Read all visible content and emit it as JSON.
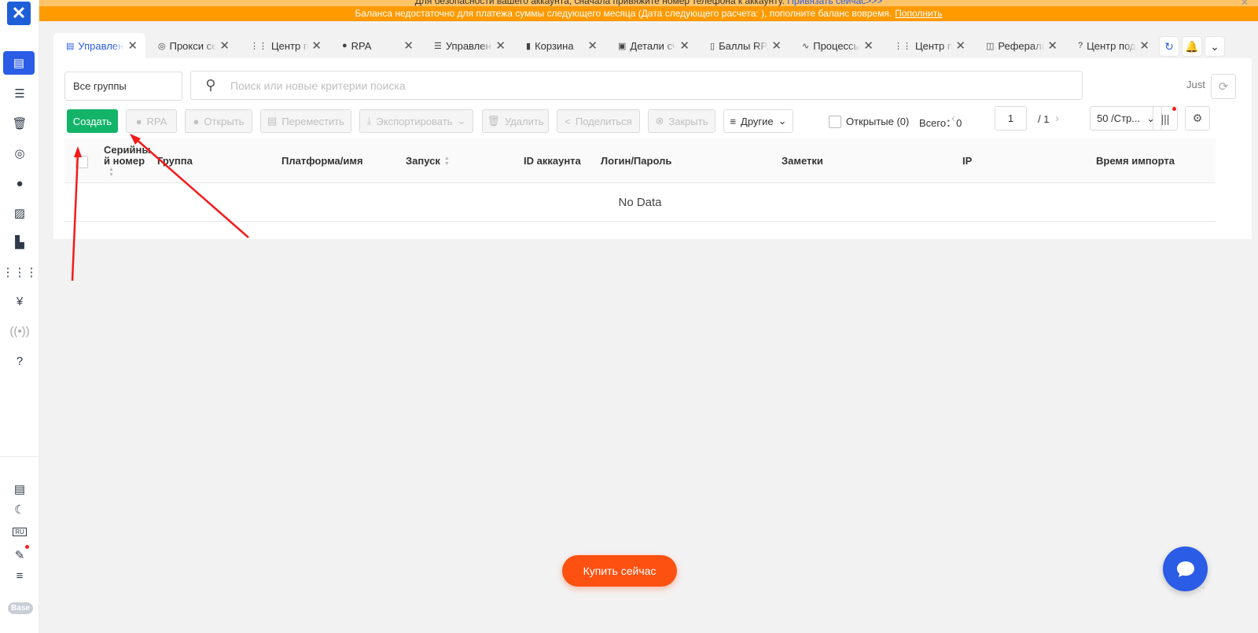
{
  "app": {
    "logo_glyph": "✕",
    "brand_color": "#2b5ce6"
  },
  "banners": {
    "security_text": "Для безопасности вашего аккаунта, сначала привяжите номер телефона к аккаунту.",
    "security_link": "Привязать сейчас>>>",
    "balance_text": "Баланса недостаточно для платежа суммы следующего месяца (Дата следующего расчета: ), пополните баланс вовремя.",
    "balance_link": "Пополнить"
  },
  "tabs": [
    {
      "label": "Управление",
      "icon": "doc-icon"
    },
    {
      "label": "Прокси серверы",
      "icon": "signal-icon"
    },
    {
      "label": "Центр приложений",
      "icon": "grid-icon"
    },
    {
      "label": "RPA",
      "icon": "robot-icon"
    },
    {
      "label": "Управление",
      "icon": "server-icon"
    },
    {
      "label": "Корзина",
      "icon": "trash-icon"
    },
    {
      "label": "Детали счета",
      "icon": "ledger-icon"
    },
    {
      "label": "Баллы RPA",
      "icon": "file-icon"
    },
    {
      "label": "Процессы",
      "icon": "pulse-icon"
    },
    {
      "label": "Центр приложений",
      "icon": "grid-icon"
    },
    {
      "label": "Рефералы",
      "icon": "referral-icon"
    },
    {
      "label": "Центр поддержки",
      "icon": "help-icon"
    }
  ],
  "toolbar": {
    "group_select": "Все группы",
    "search_placeholder": "Поиск или новые критерии поиска",
    "just": "Just",
    "create": "Создать",
    "rpa": "RPA",
    "open": "Открыть",
    "move": "Переместить",
    "export": "Экспортировать",
    "delete": "Удалить",
    "share": "Поделиться",
    "close": "Закрыть",
    "other": "Другие",
    "opened": "Открытые (0)",
    "total_label": "Всего：",
    "total_value": "0",
    "page": "1",
    "page_total": "/ 1",
    "page_size": "50 /Стр..."
  },
  "table": {
    "columns": [
      "Серийный номер",
      "Группа",
      "Платформа/имя",
      "Запуск",
      "ID аккаунта",
      "Логин/Пароль",
      "Заметки",
      "IP",
      "Время импорта"
    ],
    "empty": "No Data"
  },
  "sidebar": {
    "lang": "RU",
    "base": "Base"
  },
  "floating": {
    "buy_now": "Купить сейчас"
  },
  "colors": {
    "create_green": "#13b46a",
    "buy_orange": "#fd5111",
    "banner_orange": "#ff9a00",
    "annotation_red": "#f41a1a"
  }
}
